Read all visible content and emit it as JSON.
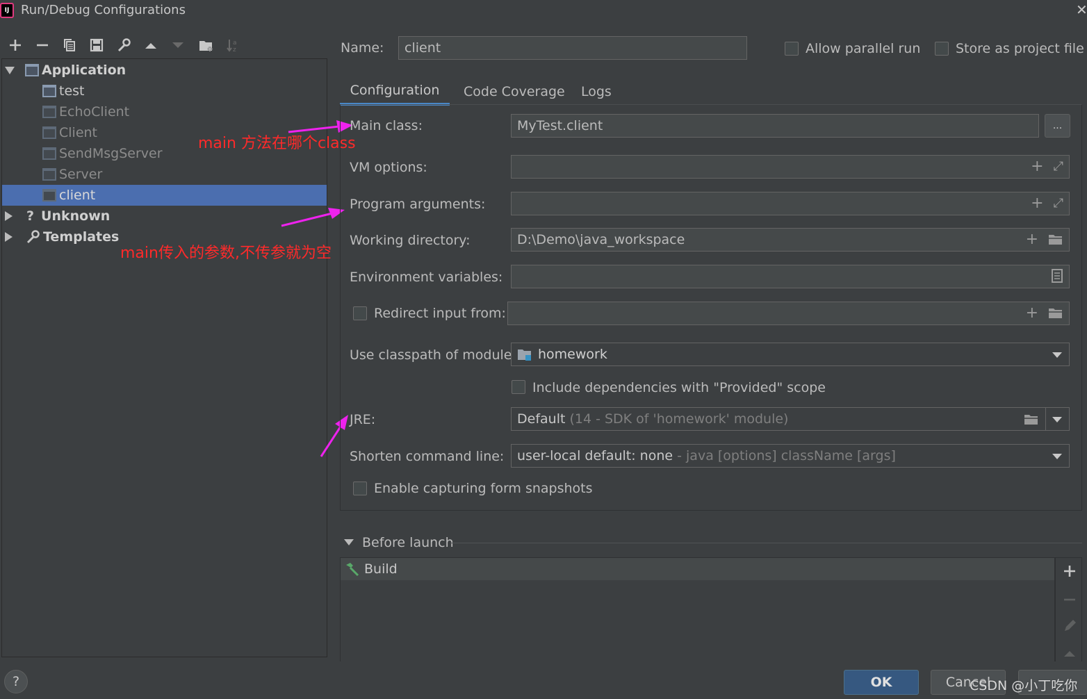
{
  "window": {
    "title": "Run/Debug Configurations",
    "logo_text": "IJ"
  },
  "toolbar": {
    "icons": [
      "add-icon",
      "remove-icon",
      "copy-icon",
      "save-icon",
      "wrench-icon",
      "move-up-icon",
      "move-down-icon",
      "folder-add-icon",
      "sort-icon"
    ]
  },
  "tree": {
    "application_label": "Application",
    "items": [
      {
        "label": "test"
      },
      {
        "label": "EchoClient"
      },
      {
        "label": "Client"
      },
      {
        "label": "SendMsgServer"
      },
      {
        "label": "Server"
      },
      {
        "label": "client"
      }
    ],
    "unknown_label": "Unknown",
    "templates_label": "Templates"
  },
  "annotations": {
    "main_class_note": "main 方法在哪个class",
    "args_note": "main传入的参数,不传参就为空",
    "color": "#ff2a2a",
    "arrow_color": "#ee22ee"
  },
  "header": {
    "name_label": "Name:",
    "name_value": "client",
    "allow_parallel_label": "Allow parallel run",
    "store_project_label": "Store as project file"
  },
  "tabs": [
    {
      "label": "Configuration",
      "active": true
    },
    {
      "label": "Code Coverage",
      "active": false
    },
    {
      "label": "Logs",
      "active": false
    }
  ],
  "config": {
    "main_class_label": "Main class:",
    "main_class_value": "MyTest.client",
    "browse_label": "...",
    "vm_options_label": "VM options:",
    "vm_options_value": "",
    "program_args_label": "Program arguments:",
    "program_args_value": "",
    "working_dir_label": "Working directory:",
    "working_dir_value": "D:\\Demo\\java_workspace",
    "env_vars_label": "Environment variables:",
    "env_vars_value": "",
    "redirect_label": "Redirect input from:",
    "redirect_value": "",
    "classpath_label": "Use classpath of module:",
    "classpath_value": "homework",
    "include_deps_label": "Include dependencies with \"Provided\" scope",
    "jre_label": "JRE:",
    "jre_value": "Default",
    "jre_hint": "(14 - SDK of 'homework' module)",
    "shorten_label": "Shorten command line:",
    "shorten_value": "user-local default: none",
    "shorten_hint": " - java [options] className [args]",
    "snapshots_label": "Enable capturing form snapshots"
  },
  "before_launch": {
    "label": "Before launch",
    "tasks": [
      {
        "label": "Build"
      }
    ]
  },
  "footer": {
    "help_label": "?",
    "ok_label": "OK",
    "cancel_label": "Cancel",
    "watermark": "CSDN @小丁吃你"
  },
  "colors": {
    "background": "#3c3f41",
    "selection": "#4b6eaf",
    "tab_underline": "#4a88c7",
    "primary_button": "#365880"
  }
}
